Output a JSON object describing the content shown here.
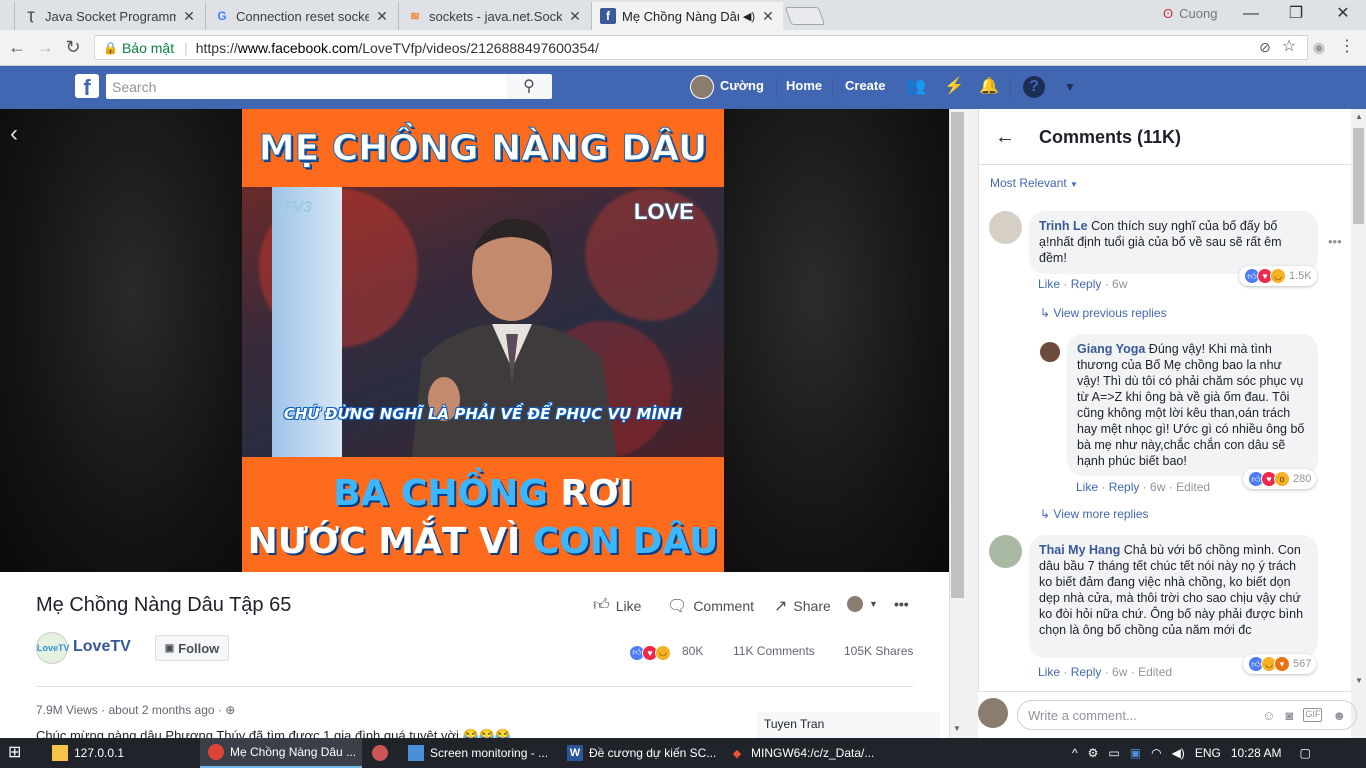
{
  "browser": {
    "tabs": [
      {
        "title": "Java Socket Programming",
        "icon": "java-icon"
      },
      {
        "title": "Connection reset socket",
        "icon": "google-icon"
      },
      {
        "title": "sockets - java.net.Socket",
        "icon": "stackoverflow-icon"
      },
      {
        "title": "Mẹ Chồng Nàng Dâu",
        "icon": "facebook-icon"
      }
    ],
    "user": "Cuong",
    "secure_label": "Bảo mật",
    "url_prefix": "https://",
    "url_host": "www.facebook.com",
    "url_path": "/LoveTVfp/videos/2126888497600354/"
  },
  "fb": {
    "logo": "f",
    "search_placeholder": "Search",
    "user_name": "Cường",
    "home": "Home",
    "create": "Create"
  },
  "video": {
    "top_text": "MẸ CHỒNG NÀNG DÂU",
    "channel_logo": "LOVE",
    "tv_logo": "VTV3",
    "caption": "CHỨ ĐỪNG NGHĨ LÀ PHẢI VỀ ĐỂ PHỤC VỤ MÌNH",
    "bottom_line1_a": "BA CHỒNG",
    "bottom_line1_b": " RƠI",
    "bottom_line2_a": "NƯỚC MẮT VÌ ",
    "bottom_line2_b": "CON DÂU",
    "title": "Mẹ Chồng Nàng Dâu Tập 65"
  },
  "actions": {
    "like": "Like",
    "comment": "Comment",
    "share": "Share",
    "more": "•••"
  },
  "page": {
    "avatar_text": "LoveTV",
    "name": "LoveTV",
    "follow": "Follow"
  },
  "stats": {
    "reactions": "80K",
    "comments": "11K Comments",
    "shares": "105K Shares"
  },
  "meta": {
    "views": "7.9M Views · about 2 months ago ·",
    "description": "Chúc mừng nàng dâu Phương Thúy đã tìm được 1 gia đình quá tuyệt vời 😂😂😂",
    "side_name": "Tuyen Tran"
  },
  "comments_panel": {
    "title": "Comments (11K)",
    "sort": "Most Relevant",
    "comments": [
      {
        "name": "Trinh Le",
        "text": "Con thích suy nghĩ của bố đấy bố ạ!nhất định tuổi già của bố về sau sẽ rất êm đềm!",
        "like": "Like",
        "reply": "Reply",
        "time": "6w",
        "reactions": "1.5K"
      },
      {
        "name": "Giang Yoga",
        "text": "Đúng vậy! Khi mà tình thương của Bố Mẹ chồng bao la như vậy! Thì dù tôi có phải chăm sóc phục vụ từ A=>Z khi ông bà về già ốm đau. Tôi cũng không một lời kêu than,oán trách hay mệt nhọc gì! Ước gì có nhiều ông bố bà mẹ như này,chắc chắn con dâu sẽ hạnh phúc biết bao!",
        "like": "Like",
        "reply": "Reply",
        "time": "6w",
        "edited": "Edited",
        "reactions": "280"
      },
      {
        "name": "Thai My Hang",
        "text": "Chả bù với bố chồng mình. Con dâu bầu 7 tháng tết chúc tết nói này nọ ý trách ko biết đảm đang việc nhà chồng, ko biết dọn dẹp nhà cửa, mà thôi trời cho sao chịu vậy chứ ko đòi hỏi nữa chứ. Ông bố này phải được bình chọn là ông bố chồng của năm mới đc",
        "like": "Like",
        "reply": "Reply",
        "time": "6w",
        "edited": "Edited",
        "reactions": "567"
      }
    ],
    "view_previous": "View previous replies",
    "view_more": "View more replies",
    "write_placeholder": "Write a comment..."
  },
  "taskbar": {
    "items": [
      "127.0.0.1",
      "Mẹ Chồng Nàng Dâu ...",
      "",
      "Screen monitoring - ...",
      "Đề cương dự kiến SC...",
      "MINGW64:/c/z_Data/..."
    ],
    "lang": "ENG",
    "time": "10:28 AM"
  }
}
